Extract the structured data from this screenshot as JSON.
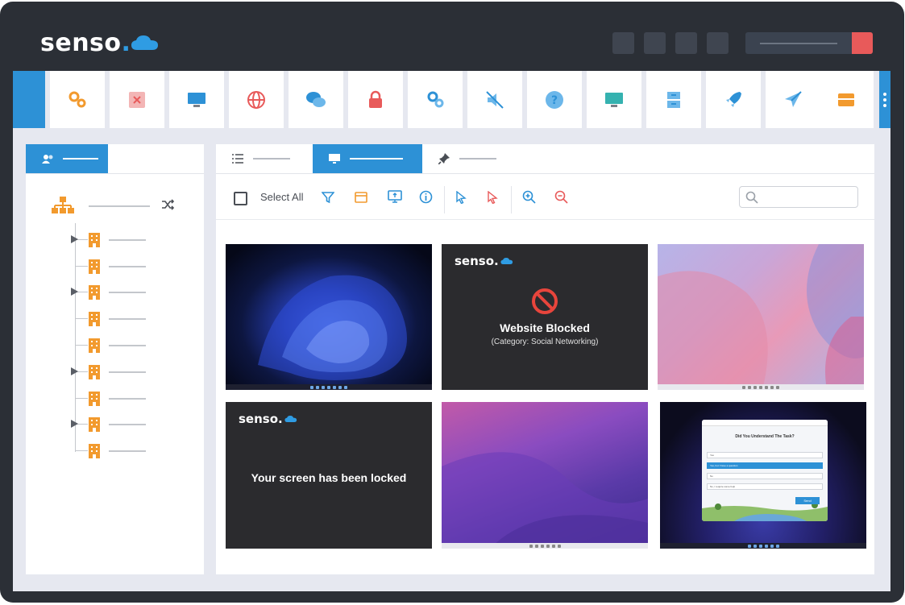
{
  "brand": {
    "name": "senso",
    "dot": "."
  },
  "toolbar": {
    "icons": [
      "gears-icon",
      "close-square-icon",
      "monitor-icon",
      "globe-icon",
      "chat-icon",
      "lock-icon",
      "settings-icon",
      "mute-icon",
      "help-icon",
      "screen-icon",
      "archive-icon",
      "rocket-icon",
      "send-icon",
      "card-icon"
    ]
  },
  "actions": {
    "select_all": "Select All"
  },
  "thumbnails": {
    "blocked": {
      "logo": "senso.",
      "title": "Website Blocked",
      "subtitle": "(Category: Social Networking)"
    },
    "locked": {
      "logo": "senso.",
      "title": "Your screen has been locked"
    },
    "quiz": {
      "title": "Did You Understand The Task?",
      "options": [
        "Yes",
        "Yes, but I have a question",
        "No",
        "No, I require some help"
      ],
      "send": "Send"
    }
  },
  "colors": {
    "accent": "#2d91d6",
    "frame": "#2b2f36",
    "orange": "#f29a2e",
    "red": "#e85a5a"
  }
}
